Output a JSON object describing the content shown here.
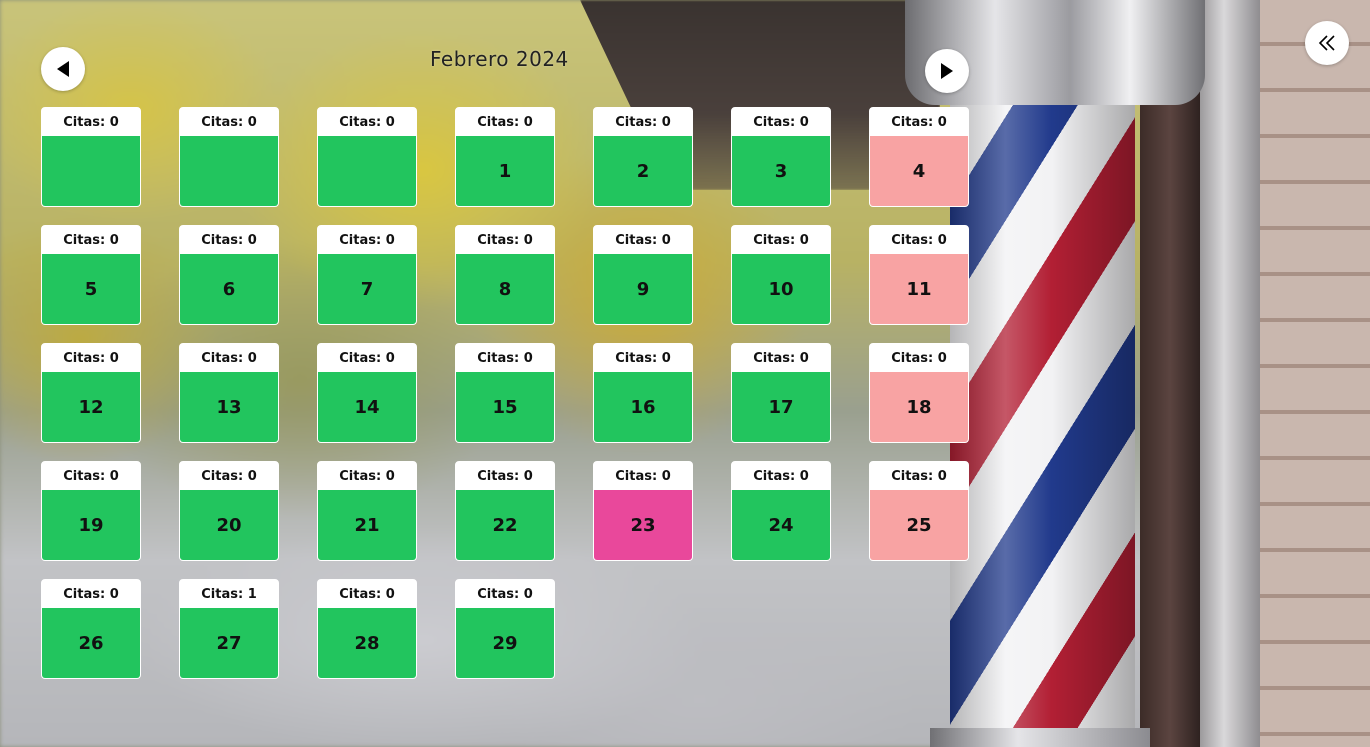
{
  "header": {
    "month_title": "Febrero 2024",
    "prev_icon": "triangle-left-icon",
    "next_icon": "triangle-right-icon",
    "back_icon": "double-chevron-left-icon"
  },
  "colors": {
    "available": "#22c55e",
    "closed": "#f8a3a3",
    "selected": "#e9489b",
    "header_bg": "#ffffff"
  },
  "calendar": {
    "days": [
      {
        "count": "Citas: 0",
        "num": "",
        "status": "empty"
      },
      {
        "count": "Citas: 0",
        "num": "",
        "status": "empty"
      },
      {
        "count": "Citas: 0",
        "num": "",
        "status": "empty"
      },
      {
        "count": "Citas: 0",
        "num": "1",
        "status": "available"
      },
      {
        "count": "Citas: 0",
        "num": "2",
        "status": "available"
      },
      {
        "count": "Citas: 0",
        "num": "3",
        "status": "available"
      },
      {
        "count": "Citas: 0",
        "num": "4",
        "status": "blocked"
      },
      {
        "count": "Citas: 0",
        "num": "5",
        "status": "available"
      },
      {
        "count": "Citas: 0",
        "num": "6",
        "status": "available"
      },
      {
        "count": "Citas: 0",
        "num": "7",
        "status": "available"
      },
      {
        "count": "Citas: 0",
        "num": "8",
        "status": "available"
      },
      {
        "count": "Citas: 0",
        "num": "9",
        "status": "available"
      },
      {
        "count": "Citas: 0",
        "num": "10",
        "status": "available"
      },
      {
        "count": "Citas: 0",
        "num": "11",
        "status": "blocked"
      },
      {
        "count": "Citas: 0",
        "num": "12",
        "status": "available"
      },
      {
        "count": "Citas: 0",
        "num": "13",
        "status": "available"
      },
      {
        "count": "Citas: 0",
        "num": "14",
        "status": "available"
      },
      {
        "count": "Citas: 0",
        "num": "15",
        "status": "available"
      },
      {
        "count": "Citas: 0",
        "num": "16",
        "status": "available"
      },
      {
        "count": "Citas: 0",
        "num": "17",
        "status": "available"
      },
      {
        "count": "Citas: 0",
        "num": "18",
        "status": "blocked"
      },
      {
        "count": "Citas: 0",
        "num": "19",
        "status": "available"
      },
      {
        "count": "Citas: 0",
        "num": "20",
        "status": "available"
      },
      {
        "count": "Citas: 0",
        "num": "21",
        "status": "available"
      },
      {
        "count": "Citas: 0",
        "num": "22",
        "status": "available"
      },
      {
        "count": "Citas: 0",
        "num": "23",
        "status": "today"
      },
      {
        "count": "Citas: 0",
        "num": "24",
        "status": "available"
      },
      {
        "count": "Citas: 0",
        "num": "25",
        "status": "blocked"
      },
      {
        "count": "Citas: 0",
        "num": "26",
        "status": "available"
      },
      {
        "count": "Citas: 1",
        "num": "27",
        "status": "available"
      },
      {
        "count": "Citas: 0",
        "num": "28",
        "status": "available"
      },
      {
        "count": "Citas: 0",
        "num": "29",
        "status": "available"
      }
    ]
  }
}
